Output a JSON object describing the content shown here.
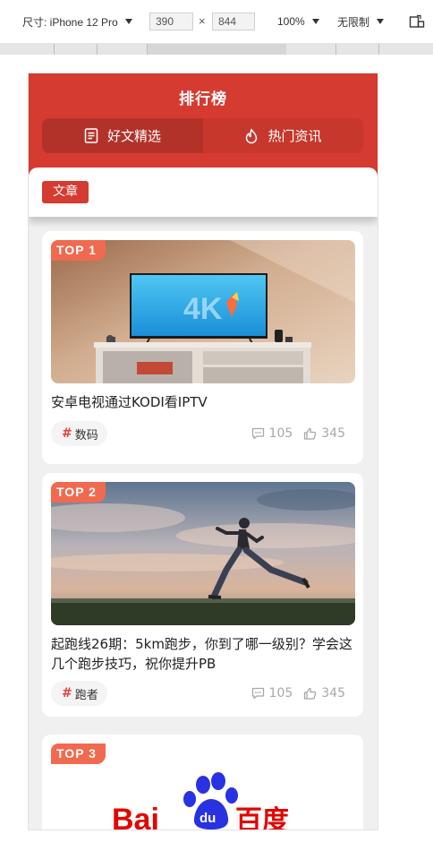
{
  "devtools": {
    "device_label": "尺寸: iPhone 12 Pro",
    "width": "390",
    "times": "×",
    "height": "844",
    "zoom": "100%",
    "throttle": "无限制"
  },
  "header": {
    "title": "排行榜",
    "tabs": [
      {
        "label": "好文精选",
        "icon": "document-icon",
        "active": true
      },
      {
        "label": "热门资讯",
        "icon": "flame-icon",
        "active": false
      }
    ]
  },
  "category": {
    "label": "文章",
    "color": "#d53b30"
  },
  "articles": [
    {
      "rank": "TOP 1",
      "title": "安卓电视通过KODI看IPTV",
      "tag": "数码",
      "comments": "105",
      "likes": "345"
    },
    {
      "rank": "TOP 2",
      "title": "起跑线26期：5km跑步，你到了哪一级别？学会这几个跑步技巧，祝你提升PB",
      "tag": "跑者",
      "comments": "105",
      "likes": "345"
    },
    {
      "rank": "TOP 3",
      "logo_text": "Bai 百度"
    }
  ],
  "colors": {
    "brand": "#d53b30",
    "badge": "#f06a50"
  }
}
